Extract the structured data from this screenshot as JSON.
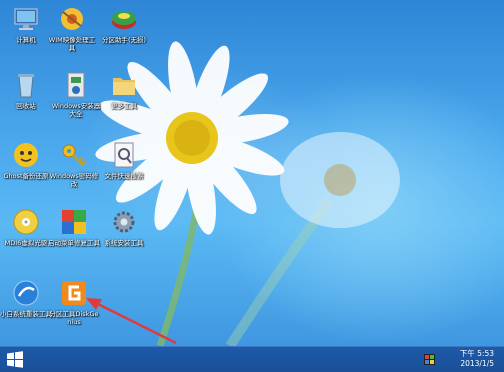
{
  "desktop_icons": [
    {
      "label": "计算机",
      "icon": "computer-icon"
    },
    {
      "label": "WIM映像处理工具",
      "icon": "wim-tool-icon"
    },
    {
      "label": "分区助手(无损)",
      "icon": "partition-assistant-icon"
    },
    {
      "label": "回收站",
      "icon": "recycle-bin-icon"
    },
    {
      "label": "Windows安装器大全",
      "icon": "windows-installer-icon"
    },
    {
      "label": "更多工具",
      "icon": "folder-icon"
    },
    {
      "label": "Ghost备份还原",
      "icon": "ghost-icon"
    },
    {
      "label": "Windows密码修改",
      "icon": "key-icon"
    },
    {
      "label": "文件快速搜索",
      "icon": "file-search-icon"
    },
    {
      "label": "MDI6虚拟光驱",
      "icon": "virtual-drive-icon"
    },
    {
      "label": "启动菜单修复工具",
      "icon": "boot-repair-icon"
    },
    {
      "label": "系统安装工具",
      "icon": "gear-icon"
    },
    {
      "label": "小白系统重装工具",
      "icon": "reinstall-tool-icon"
    },
    {
      "label": "分区工具DiskGenius",
      "icon": "diskgenius-icon"
    }
  ],
  "taskbar": {
    "start_icon": "windows-logo-icon",
    "tray_icon": "network-tray-icon",
    "time": "下午 5:53",
    "date": "2013/1/5"
  },
  "colors": {
    "desktop_blue": "#3f97e0",
    "taskbar": "#1a4f97",
    "arrow_red": "#e23a3a"
  }
}
